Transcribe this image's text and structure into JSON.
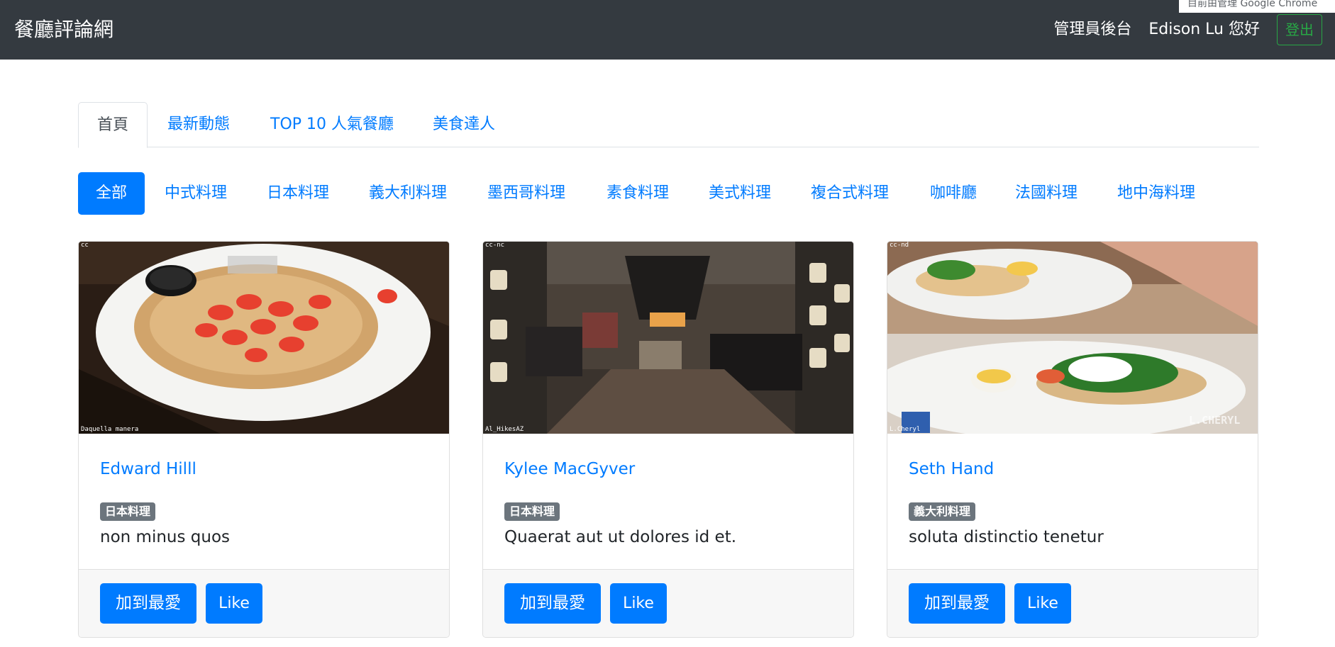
{
  "navbar": {
    "brand": "餐廳評論網",
    "admin_link": "管理員後台",
    "greeting": "Edison Lu 您好",
    "logout_label": "登出",
    "tooltip": "目前由管理 Google Chrome"
  },
  "tabs": [
    {
      "label": "首頁",
      "active": true
    },
    {
      "label": "最新動態",
      "active": false
    },
    {
      "label": "TOP 10 人氣餐廳",
      "active": false
    },
    {
      "label": "美食達人",
      "active": false
    }
  ],
  "categories": [
    {
      "label": "全部",
      "active": true
    },
    {
      "label": "中式料理"
    },
    {
      "label": "日本料理"
    },
    {
      "label": "義大利料理"
    },
    {
      "label": "墨西哥料理"
    },
    {
      "label": "素食料理"
    },
    {
      "label": "美式料理"
    },
    {
      "label": "複合式料理"
    },
    {
      "label": "咖啡廳"
    },
    {
      "label": "法國料理"
    },
    {
      "label": "地中海料理"
    }
  ],
  "cards": [
    {
      "title": "Edward Hilll",
      "category": "日本料理",
      "description": "non minus quos",
      "image_license": "cc",
      "image_credit": "Daquella manera",
      "fav_label": "加到最愛",
      "like_label": "Like"
    },
    {
      "title": "Kylee MacGyver",
      "category": "日本料理",
      "description": "Quaerat aut ut dolores id et.",
      "image_license": "cc-nc",
      "image_credit": "Al_HikesAZ",
      "fav_label": "加到最愛",
      "like_label": "Like"
    },
    {
      "title": "Seth Hand",
      "category": "義大利料理",
      "description": "soluta distinctio tenetur",
      "image_license": "cc-nd",
      "image_credit": "L.Cheryl",
      "watermark": "L.CHERYL",
      "fav_label": "加到最愛",
      "like_label": "Like"
    }
  ],
  "colors": {
    "navbar_bg": "#343a40",
    "primary": "#007bff",
    "success": "#28a745",
    "badge": "#6c757d"
  }
}
